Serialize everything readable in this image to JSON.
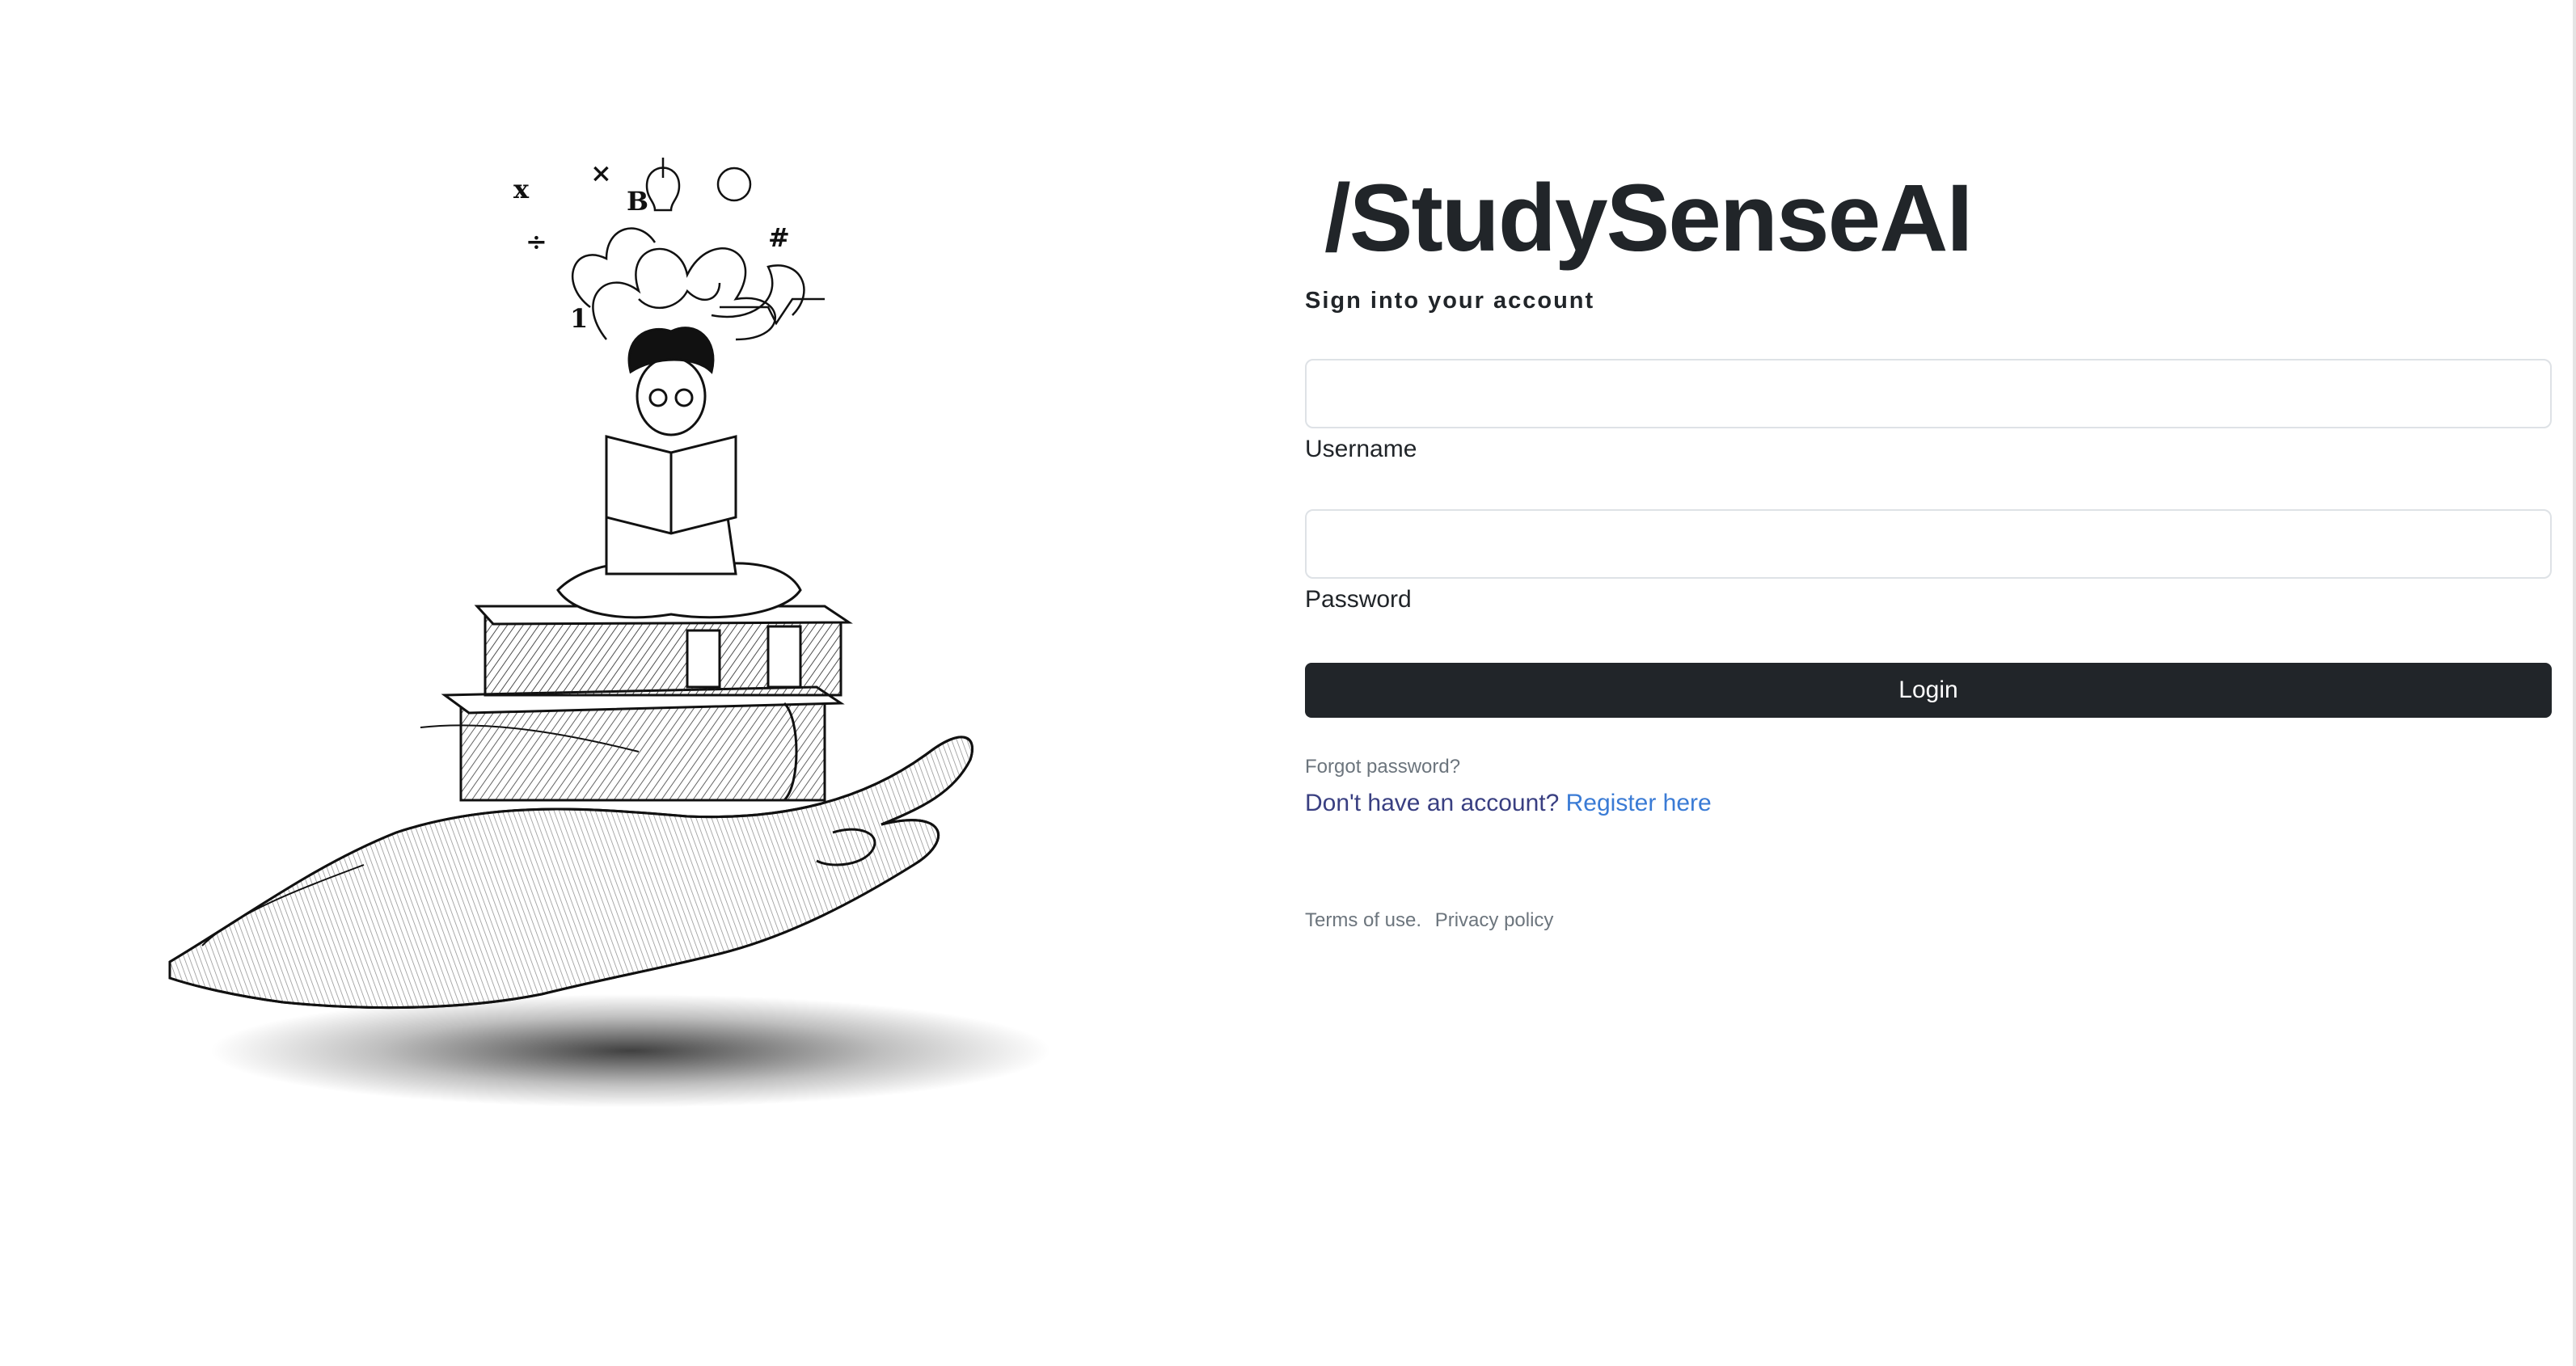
{
  "brand": {
    "title": "/StudySenseAI"
  },
  "login": {
    "subtitle": "Sign into your account",
    "username_label": "Username",
    "username_value": "",
    "password_label": "Password",
    "password_value": "",
    "submit_label": "Login",
    "forgot_password": "Forgot password?",
    "register_prompt": "Don't have an account?",
    "register_link": "Register here"
  },
  "footer": {
    "terms": "Terms of use.",
    "privacy": "Privacy policy"
  },
  "illustration": {
    "icon": "student-reading-on-books-in-hand-illustration",
    "symbols": [
      "x",
      "×",
      "B",
      "#",
      "1",
      "√",
      "÷"
    ]
  },
  "colors": {
    "primary_button": "#212529",
    "link": "#3a7bd5",
    "register_prompt": "#393f81",
    "muted": "#6c757d",
    "input_border": "#dee2e6"
  }
}
